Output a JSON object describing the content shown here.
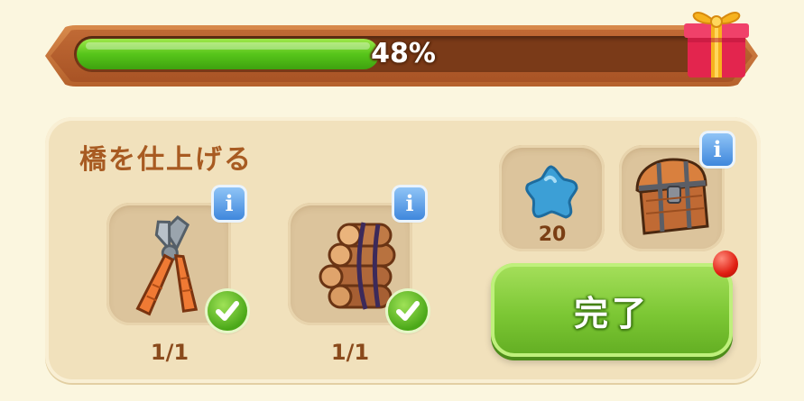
{
  "progress": {
    "percent_text": "48%",
    "value": 0.48
  },
  "task": {
    "title": "橋を仕上げる",
    "items": [
      {
        "name": "pliers",
        "count": "1/1",
        "complete": true
      },
      {
        "name": "logs",
        "count": "1/1",
        "complete": true
      }
    ]
  },
  "rewards": {
    "star_count": "20"
  },
  "done_button": {
    "label": "完了"
  },
  "info_label": "i",
  "colors": {
    "progress_fill": "#57c51a",
    "done_button": "#7cc734",
    "notification": "#e01f12"
  }
}
